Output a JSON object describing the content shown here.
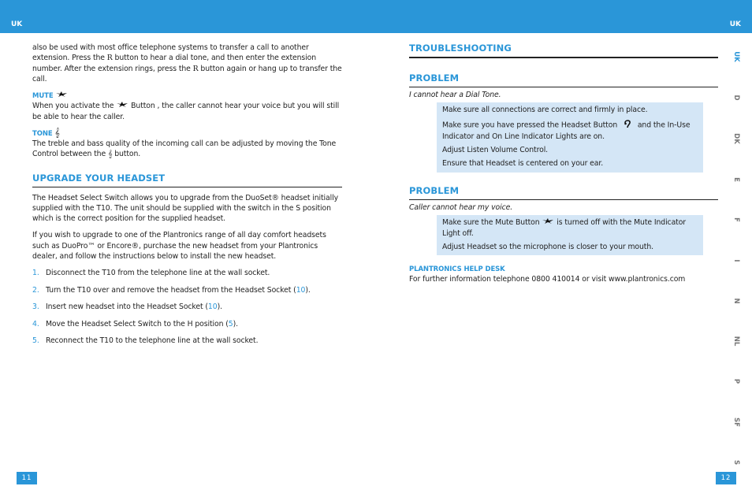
{
  "header": {
    "left_lang": "UK",
    "right_lang": "UK"
  },
  "left_page": {
    "intro_paragraph": {
      "part1": "also be used with most office telephone systems to transfer a call to another extension. Press the ",
      "r_button": "R",
      "part2": " button to hear a dial tone, and then enter the extension number. After the extension rings, press the ",
      "part3": " button again or hang up to transfer the call."
    },
    "mute": {
      "heading": "MUTE",
      "icon": "mute-icon",
      "text_before": "When you activate the ",
      "text_after": " Button , the caller cannot hear your voice but you will still be able to hear the caller."
    },
    "tone": {
      "heading": "TONE",
      "icon": "treble-clef-icon",
      "text_before": "The treble and bass quality of the incoming call can be adjusted by moving the Tone Control between the ",
      "text_after": " button."
    },
    "upgrade": {
      "heading": "UPGRADE YOUR HEADSET",
      "paragraph1": "The Headset Select Switch allows you to upgrade from the DuoSet® headset initially supplied with the T10. The unit should be supplied with the switch in the S position which is the correct position for the supplied headset.",
      "paragraph2": "If you wish to upgrade to one of the Plantronics range of all day comfort headsets such as DuoPro™ or Encore®, purchase the new headset from your Plantronics dealer, and follow the instructions below to install the new headset.",
      "steps": [
        {
          "num": "1.",
          "text": "Disconnect the T10 from the telephone line at the wall socket.",
          "ref": "",
          "suffix": ""
        },
        {
          "num": "2.",
          "text": "Turn the T10 over and remove the headset from the Headset Socket (",
          "ref": "10",
          "suffix": ")."
        },
        {
          "num": "3.",
          "text": "Insert new headset into the Headset Socket (",
          "ref": "10",
          "suffix": ")."
        },
        {
          "num": "4.",
          "text": "Move the Headset Select Switch to the H position (",
          "ref": "5",
          "suffix": ")."
        },
        {
          "num": "5.",
          "text": "Reconnect the T10 to the telephone line at the wall socket.",
          "ref": "",
          "suffix": ""
        }
      ]
    },
    "page_number": "11"
  },
  "right_page": {
    "heading": "TROUBLESHOOTING",
    "problems": [
      {
        "heading": "PROBLEM",
        "problem": "I cannot hear a Dial Tone.",
        "solutions": [
          "Make sure all connections are correct and firmly in place.",
          "Make sure you have pressed the Headset Button",
          "and the In-Use Indicator and On Line Indicator Lights are on.",
          "Adjust Listen Volume Control.",
          "Ensure that Headset is centered on your ear."
        ]
      },
      {
        "heading": "PROBLEM",
        "problem": "Caller cannot hear my voice.",
        "solutions": [
          "Make sure the Mute Button",
          "is turned off with the Mute Indicator Light off.",
          "Adjust Headset so the microphone is closer to your mouth."
        ]
      }
    ],
    "help_desk": {
      "heading": "PLANTRONICS HELP DESK",
      "text": "For further information telephone 0800 410014 or visit www.plantronics.com"
    },
    "page_number": "12"
  },
  "side_tabs": [
    "UK",
    "D",
    "DK",
    "E",
    "F",
    "I",
    "N",
    "NL",
    "P",
    "SF",
    "S"
  ],
  "colors": {
    "accent": "#2a96d8",
    "solution_bg": "#d4e6f6",
    "tab_inactive": "#777777"
  }
}
